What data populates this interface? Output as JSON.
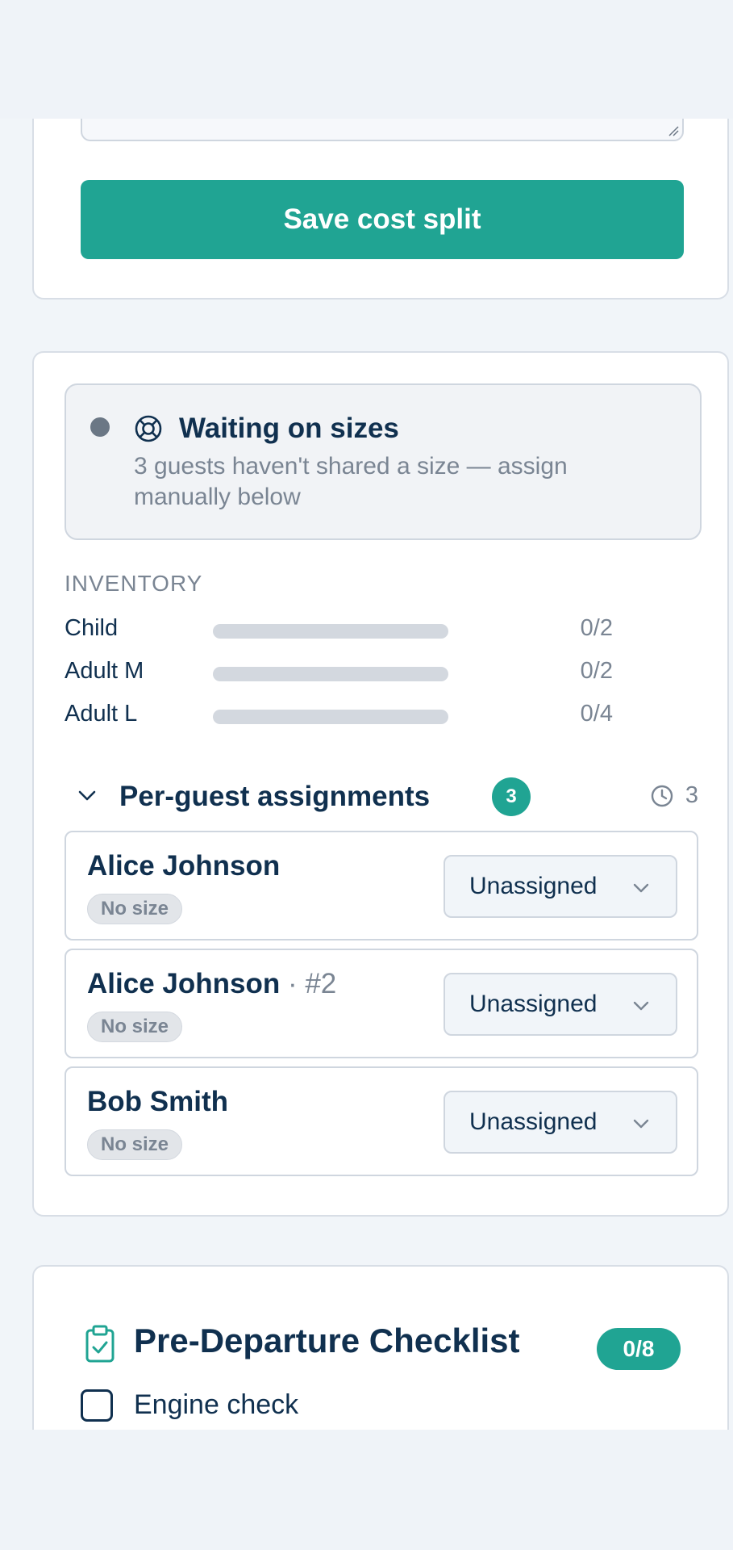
{
  "cost_split": {
    "save_label": "Save cost split"
  },
  "sizes_alert": {
    "title": "Waiting on sizes",
    "description": "3 guests haven't shared a size — assign manually below",
    "icon": "lifebuoy-icon"
  },
  "inventory": {
    "label": "INVENTORY",
    "rows": [
      {
        "name": "Child",
        "count": "0/2",
        "fill": 0
      },
      {
        "name": "Adult M",
        "count": "0/2",
        "fill": 0
      },
      {
        "name": "Adult L",
        "count": "0/4",
        "fill": 0
      }
    ]
  },
  "assignments": {
    "title": "Per-guest assignments",
    "badge": "3",
    "pending_count": "3",
    "guests": [
      {
        "name": "Alice Johnson",
        "suffix": "",
        "size_badge": "No size",
        "select_value": "Unassigned"
      },
      {
        "name": "Alice Johnson",
        "suffix": " · #2",
        "size_badge": "No size",
        "select_value": "Unassigned"
      },
      {
        "name": "Bob Smith",
        "suffix": "",
        "size_badge": "No size",
        "select_value": "Unassigned"
      }
    ]
  },
  "checklist": {
    "title": "Pre-Departure Checklist",
    "progress": "0/8",
    "items": [
      {
        "label": "Engine check",
        "checked": false
      }
    ]
  },
  "colors": {
    "accent": "#20a493",
    "text": "#10304f",
    "muted": "#7a8593"
  }
}
